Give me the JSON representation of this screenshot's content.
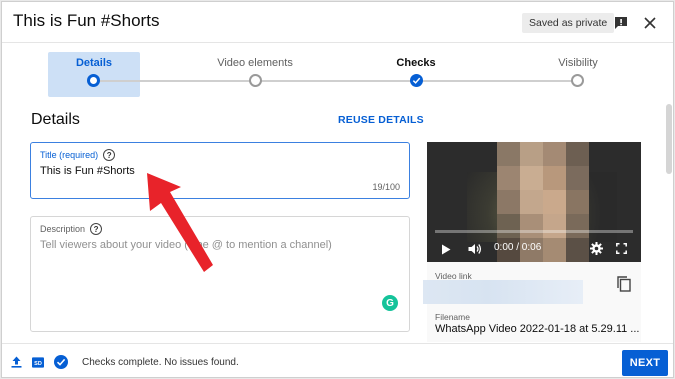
{
  "header": {
    "title": "This is Fun #Shorts",
    "saved_badge": "Saved as private",
    "feedback_icon": "feedback-icon",
    "close_icon": "close-icon"
  },
  "stepper": {
    "steps": [
      {
        "label": "Details",
        "state": "active"
      },
      {
        "label": "Video elements",
        "state": "pending"
      },
      {
        "label": "Checks",
        "state": "done"
      },
      {
        "label": "Visibility",
        "state": "pending"
      }
    ]
  },
  "main": {
    "section_title": "Details",
    "reuse_label": "REUSE DETAILS",
    "title_field": {
      "label": "Title (required)",
      "value": "This is Fun #Shorts",
      "counter": "19/100"
    },
    "description_field": {
      "label": "Description",
      "placeholder": "Tell viewers about your video (type @ to mention a channel)"
    }
  },
  "preview": {
    "time": "0:00 / 0:06",
    "video_link_label": "Video link",
    "filename_label": "Filename",
    "filename": "WhatsApp Video 2022-01-18 at 5.29.11 ..."
  },
  "footer": {
    "status": "Checks complete. No issues found.",
    "next_label": "NEXT"
  },
  "colors": {
    "accent": "#065fd4",
    "active_step_bg": "#cde0f6",
    "annotation_arrow": "#e8232a"
  }
}
